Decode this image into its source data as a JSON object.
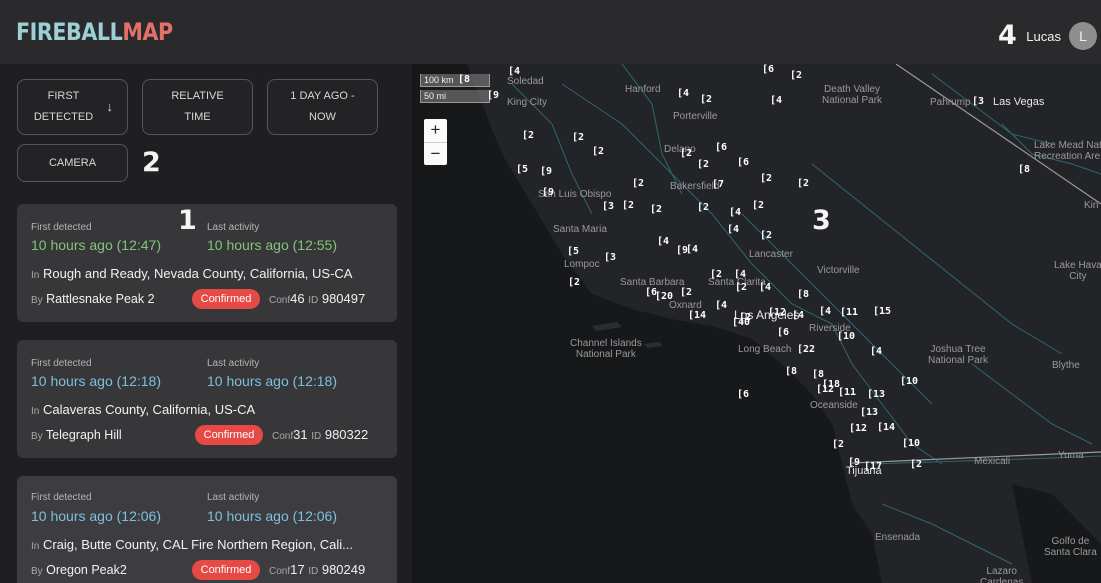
{
  "app": {
    "logo_part1": "FIREBALL",
    "logo_part2": "MAP",
    "user_name": "Lucas",
    "user_initial": "L"
  },
  "annotations": [
    "1",
    "2",
    "3",
    "4"
  ],
  "filters": {
    "first_detected": "FIRST DETECTED",
    "relative_time": "RELATIVE TIME",
    "range": "1 DAY AGO - NOW",
    "camera": "CAMERA"
  },
  "incidents": [
    {
      "first_label": "First detected",
      "last_label": "Last activity",
      "first": "10 hours ago (12:47)",
      "last": "10 hours ago (12:55)",
      "in_prefix": "In",
      "location": "Rough and Ready, Nevada County, California, US-CA",
      "by_prefix": "By",
      "camera": "Rattlesnake Peak 2",
      "status": "Confirmed",
      "conf_label": "Conf",
      "conf": "46",
      "id_label": "ID",
      "id": "980497"
    },
    {
      "first_label": "First detected",
      "last_label": "Last activity",
      "first": "10 hours ago (12:18)",
      "last": "10 hours ago (12:18)",
      "in_prefix": "In",
      "location": "Calaveras County, California, US-CA",
      "by_prefix": "By",
      "camera": "Telegraph Hill",
      "status": "Confirmed",
      "conf_label": "Conf",
      "conf": "31",
      "id_label": "ID",
      "id": "980322"
    },
    {
      "first_label": "First detected",
      "last_label": "Last activity",
      "first": "10 hours ago (12:06)",
      "last": "10 hours ago (12:06)",
      "in_prefix": "In",
      "location": "Craig, Butte County, CAL Fire Northern Region, Cali...",
      "by_prefix": "By",
      "camera": "Oregon Peak2",
      "status": "Confirmed",
      "conf_label": "Conf",
      "conf": "17",
      "id_label": "ID",
      "id": "980249"
    }
  ],
  "map": {
    "scale_km": "100 km",
    "scale_mi": "50 mi",
    "zoom_in": "+",
    "zoom_out": "−",
    "places": {
      "soledad": "Soledad",
      "king_city": "King City",
      "hanford": "Hanford",
      "porterville": "Porterville",
      "death_valley": "Death Valley\nNational Park",
      "pahrump": "Pahrump",
      "las_vegas": "Las Vegas",
      "lake_mead": "Lake Mead Natio\nRecreation Are",
      "delano": "Delano",
      "bakersfield": "Bakersfield",
      "san_luis": "San Luis Obispo",
      "santa_maria": "Santa Maria",
      "lompoc": "Lompoc",
      "lancaster": "Lancaster",
      "victorville": "Victorville",
      "lake_havasu": "Lake Hava\nCity",
      "santa_barbara": "Santa Barbara",
      "santa_clarita": "Santa Clarita",
      "oxnard": "Oxnard",
      "los_angeles": "Los Angeles",
      "riverside": "Riverside",
      "long_beach": "Long Beach",
      "channel_islands": "Channel Islands\nNational Park",
      "joshua_tree": "Joshua Tree\nNational Park",
      "blythe": "Blythe",
      "oceanside": "Oceanside",
      "tijuana": "Tijuana",
      "mexicali": "Mexicali",
      "yuma": "Yuma",
      "ensenada": "Ensenada",
      "golfo": "Golfo de\nSanta Clara",
      "kingman": "Kin",
      "lazaro": "Lazaro\nCardenas"
    },
    "camera_markers": [
      "[4",
      "[8",
      "[9",
      "[6",
      "[2",
      "[4",
      "[2",
      "[4",
      "[3",
      "[2",
      "[2",
      "[2",
      "[6",
      "[2",
      "[5",
      "[9",
      "[2",
      "[6",
      "[2",
      "[7",
      "[2",
      "[2",
      "[9",
      "[3",
      "[2",
      "[2",
      "[2",
      "[4",
      "[2",
      "[4",
      "[4",
      "[2",
      "[4",
      "[9",
      "[5",
      "[3",
      "[2",
      "[4",
      "[2",
      "[8",
      "[4",
      "[2",
      "[6",
      "[20",
      "[2",
      "[14",
      "[4",
      "[2",
      "[12",
      "[4",
      "[4",
      "[11",
      "[15",
      "[40",
      "[10",
      "[6",
      "[22",
      "[8",
      "[4",
      "[8",
      "[18",
      "[12",
      "[6",
      "[11",
      "[13",
      "[10",
      "[13",
      "[12",
      "[14",
      "[2",
      "[10",
      "[9",
      "[17",
      "[2",
      "[8"
    ]
  }
}
